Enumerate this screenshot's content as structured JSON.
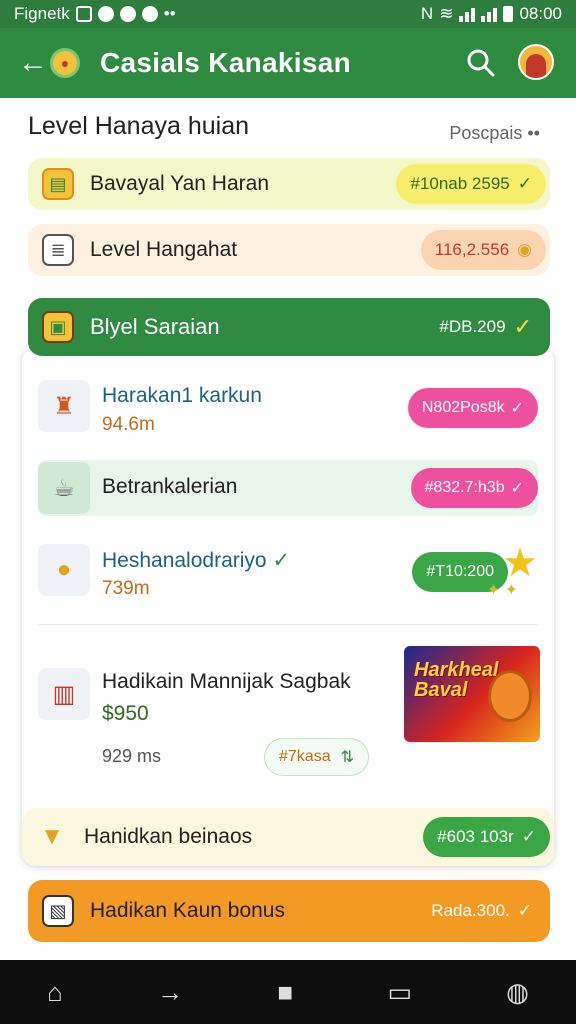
{
  "status_bar": {
    "left_text": "Fignetk",
    "time": "08:00"
  },
  "app_bar": {
    "title": "Casials Kanakisan"
  },
  "section": {
    "title": "Level Hanaya huian",
    "action": "Poscpais"
  },
  "summary_rows": [
    {
      "label": "Bavayal Yan Haran",
      "value": "#10nab 2595",
      "bg": "#f3f7c9",
      "pill_bg": "#f6ed6a",
      "pill_color": "#2f6b1f"
    },
    {
      "label": "Level Hangahat",
      "value": "116,2.556",
      "bg": "#fdf1e1",
      "pill_bg": "#fbd5b1",
      "pill_color": "#c0392b"
    }
  ],
  "card": {
    "header": {
      "label": "Blyel Saraian",
      "value": "#DB.209"
    },
    "items": [
      {
        "title": "Harakan1 karkun",
        "sub": "94.6m",
        "value": "N802Pos8k"
      },
      {
        "title": "Betrankalerian",
        "sub": "",
        "value": "#832.7:h3b"
      },
      {
        "title": "Heshanalodrariyo",
        "sub": "739m",
        "value": "#T10:200"
      },
      {
        "title": "Hadikain Mannijak Sagbak",
        "price": "$950",
        "time": "929 ms",
        "tag": "#7kasa",
        "promo_text_1": "Harkheal",
        "promo_text_2": "Baval"
      }
    ]
  },
  "bottom_rows": [
    {
      "label": "Hanidkan beinaos",
      "value": "#603 103r"
    },
    {
      "label": "Hadikan Kaun bonus",
      "value": "Rada.300."
    }
  ],
  "colors": {
    "primary": "#2f8a42",
    "pink": "#ee4f9e",
    "green": "#3aa646",
    "orange": "#f29a24"
  }
}
